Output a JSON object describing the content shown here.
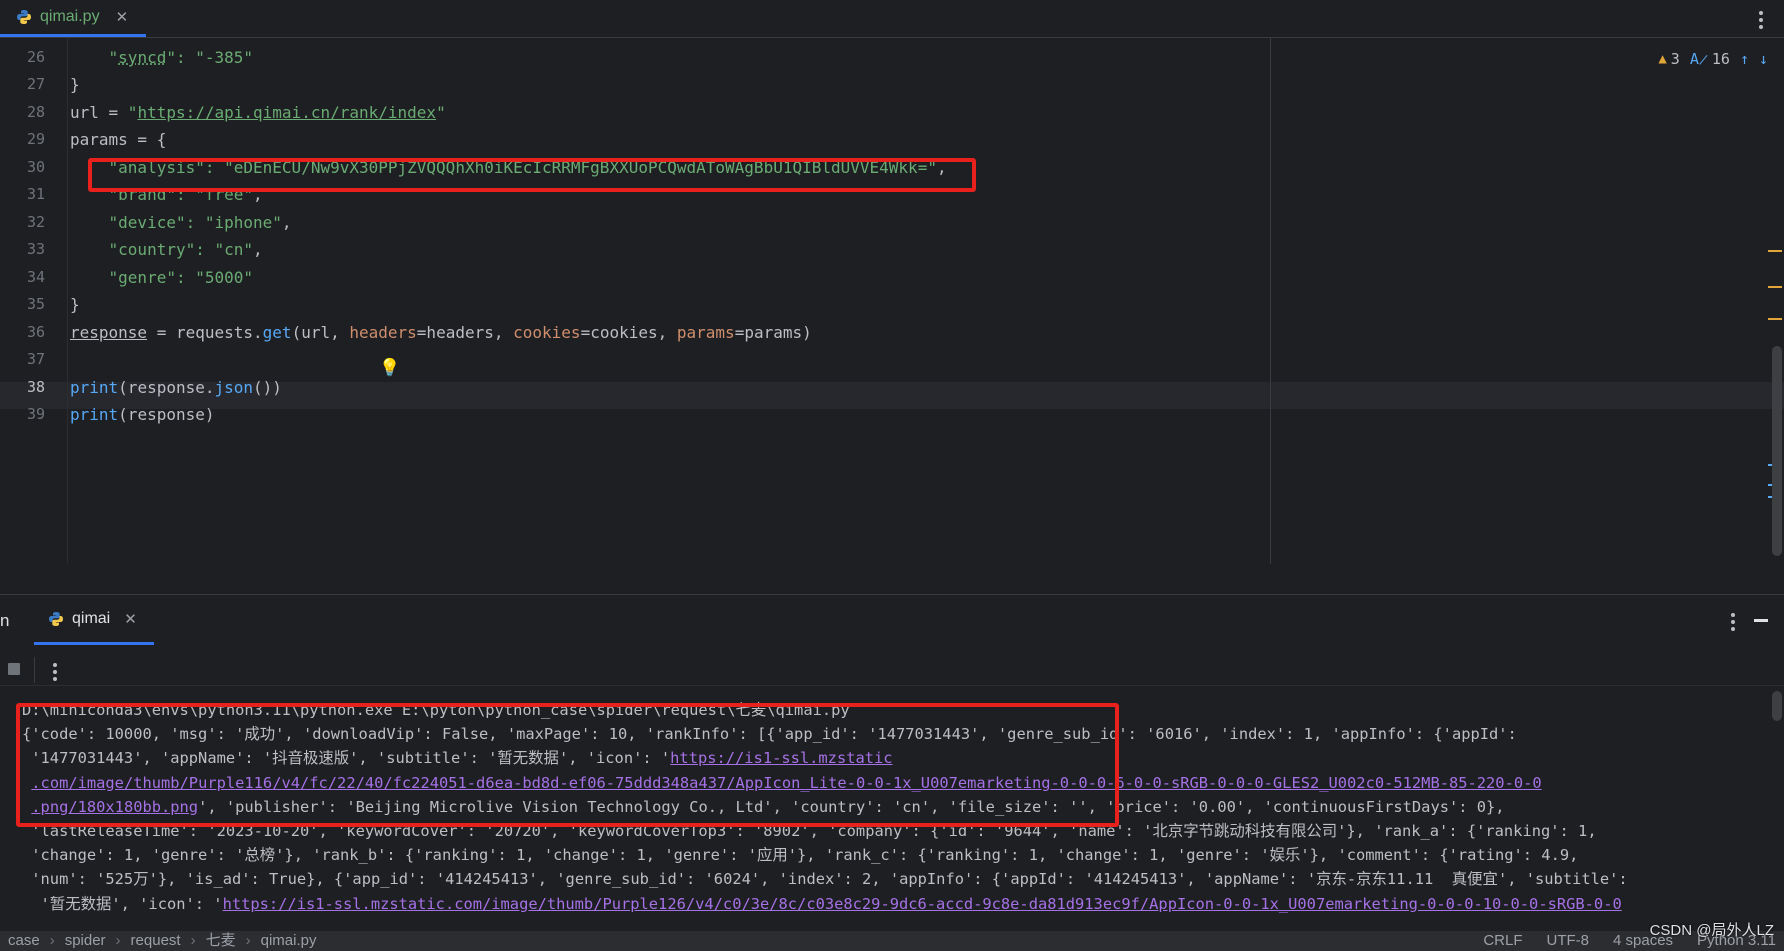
{
  "editor_tab": {
    "label": "qimai.py",
    "icon": "python-icon"
  },
  "inspections": {
    "warnings": "3",
    "typos": "16"
  },
  "code_lines": [
    {
      "num": "26",
      "parts": [
        {
          "t": "    "
        },
        {
          "t": "\"",
          "c": "s"
        },
        {
          "t": "syncd",
          "c": "s dotted"
        },
        {
          "t": "\": \"-385\"",
          "c": "s"
        }
      ]
    },
    {
      "num": "27",
      "parts": [
        {
          "t": "}"
        }
      ]
    },
    {
      "num": "28",
      "parts": [
        {
          "t": "url = "
        },
        {
          "t": "\"",
          "c": "s"
        },
        {
          "t": "https://api.qimai.cn/rank/index",
          "c": "s u"
        },
        {
          "t": "\"",
          "c": "s"
        }
      ]
    },
    {
      "num": "29",
      "parts": [
        {
          "t": "params = {"
        }
      ]
    },
    {
      "num": "30",
      "parts": [
        {
          "t": "    "
        },
        {
          "t": "\"analysis\": \"eDEnECU/Nw9vX30PPjZVQQQhXh0iKEcIcRRMFgBXXUoPCQwdAToWAgBbU1QIBldUVVE4Wkk=\"",
          "c": "s"
        },
        {
          "t": ","
        }
      ]
    },
    {
      "num": "31",
      "parts": [
        {
          "t": "    "
        },
        {
          "t": "\"brand\": \"free\"",
          "c": "s"
        },
        {
          "t": ","
        }
      ]
    },
    {
      "num": "32",
      "parts": [
        {
          "t": "    "
        },
        {
          "t": "\"device\": \"iphone\"",
          "c": "s"
        },
        {
          "t": ","
        }
      ]
    },
    {
      "num": "33",
      "parts": [
        {
          "t": "    "
        },
        {
          "t": "\"country\": \"cn\"",
          "c": "s"
        },
        {
          "t": ","
        }
      ]
    },
    {
      "num": "34",
      "parts": [
        {
          "t": "    "
        },
        {
          "t": "\"genre\": \"5000\"",
          "c": "s"
        }
      ]
    },
    {
      "num": "35",
      "parts": [
        {
          "t": "}"
        }
      ]
    },
    {
      "num": "36",
      "parts": [
        {
          "t": "response",
          "c": "u"
        },
        {
          "t": " = requests."
        },
        {
          "t": "get",
          "c": "f"
        },
        {
          "t": "(url, "
        },
        {
          "t": "headers",
          "c": "k"
        },
        {
          "t": "=headers, "
        },
        {
          "t": "cookies",
          "c": "k"
        },
        {
          "t": "=cookies, "
        },
        {
          "t": "params",
          "c": "k"
        },
        {
          "t": "=params)"
        }
      ]
    },
    {
      "num": "37",
      "parts": [
        {
          "t": ""
        }
      ]
    },
    {
      "num": "38",
      "parts": [
        {
          "t": "print",
          "c": "f"
        },
        {
          "t": "(response."
        },
        {
          "t": "json",
          "c": "f"
        },
        {
          "t": "())"
        }
      ]
    },
    {
      "num": "39",
      "parts": [
        {
          "t": "print",
          "c": "f"
        },
        {
          "t": "(response)"
        }
      ]
    }
  ],
  "run_panel": {
    "label": "n",
    "tab_label": "qimai",
    "console_lines": [
      [
        {
          "t": "D:\\miniconda3\\envs\\python3.11\\python.exe E:\\pyton\\python_case\\spider\\request\\七麦\\qimai.py"
        }
      ],
      [
        {
          "t": "{'code': 10000, 'msg': '成功', 'downloadVip': False, 'maxPage': 10, 'rankInfo': [{'app_id': '1477031443', 'genre_sub_id': '6016', 'index': 1, 'appInfo': {'appId':"
        }
      ],
      [
        {
          "t": " '1477031443', 'appName': '抖音极速版', 'subtitle': '暂无数据', 'icon': '"
        },
        {
          "t": "https://is1-ssl.mzstatic",
          "c": "link"
        }
      ],
      [
        {
          "t": " "
        },
        {
          "t": ".com/image/thumb/Purple116/v4/fc/22/40/fc224051-d6ea-bd8d-ef06-75ddd348a437/AppIcon_Lite-0-0-1x_U007emarketing-0-0-0-6-0-0-sRGB-0-0-0-GLES2_U002c0-512MB-85-220-0-0",
          "c": "link"
        }
      ],
      [
        {
          "t": " "
        },
        {
          "t": ".png/180x180bb.png",
          "c": "link"
        },
        {
          "t": "', 'publisher': 'Beijing Microlive Vision Technology Co., Ltd', 'country': 'cn', 'file_size': '', 'price': '0.00', 'continuousFirstDays': 0},"
        }
      ],
      [
        {
          "t": " 'lastReleaseTime': '2023-10-20', 'keywordCover': '20720', 'keywordCoverTop3': '8902', 'company': {'id': '9644', 'name': '北京字节跳动科技有限公司'}, 'rank_a': {'ranking': 1,"
        }
      ],
      [
        {
          "t": " 'change': 1, 'genre': '总榜'}, 'rank_b': {'ranking': 1, 'change': 1, 'genre': '应用'}, 'rank_c': {'ranking': 1, 'change': 1, 'genre': '娱乐'}, 'comment': {'rating': 4.9,"
        }
      ],
      [
        {
          "t": " 'num': '525万'}, 'is_ad': True}, {'app_id': '414245413', 'genre_sub_id': '6024', 'index': 2, 'appInfo': {'appId': '414245413', 'appName': '京东-京东11.11  真便宜', 'subtitle':"
        }
      ],
      [
        {
          "t": "  '暂无数据', 'icon': '"
        },
        {
          "t": "https://is1-ssl.mzstatic.com/image/thumb/Purple126/v4/c0/3e/8c/c03e8c29-9dc6-accd-9c8e-da81d913ec9f/AppIcon-0-0-1x_U007emarketing-0-0-0-10-0-0-sRGB-0-0",
          "c": "link"
        }
      ]
    ]
  },
  "statusbar": {
    "breadcrumb": [
      "case",
      "spider",
      "request",
      "七麦",
      "qimai.py"
    ],
    "line_sep": "CRLF",
    "encoding": "UTF-8",
    "indent": "4 spaces",
    "interpreter": "Python 3.11"
  },
  "watermark": "CSDN @局外人LZ",
  "colors": {
    "background": "#1e1f22",
    "string": "#6aab73",
    "keyword_arg": "#cf8e6d",
    "function": "#56a8f5",
    "link": "#a571e6",
    "highlight_box": "#e8211d",
    "accent": "#3574f0"
  }
}
